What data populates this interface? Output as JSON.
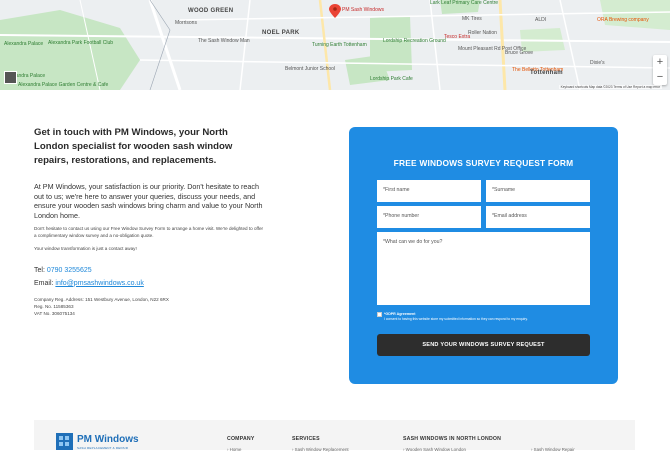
{
  "map": {
    "labels": {
      "wood_green": "WOOD GREEN",
      "noel_park": "NOEL PARK",
      "alexandra_palace": "Alexandra Palace",
      "alexandra_palace_station": "Alexandra Palace",
      "alexandra_park_football": "Alexandra Park Football Club",
      "garden_centre": "Alexandra Palace Garden Centre & Cafe",
      "morrisons": "Morrisons",
      "sash_window_man": "The Sash Window Man",
      "pm_sash_windows": "PM Sash Windows",
      "lordship_rec": "Lordship Recreation Ground",
      "turning_earth": "Turning Earth Tottenham",
      "lordship_park": "Lordship Park Cafe",
      "belmont": "Belmont Junior School",
      "tesco": "Tesco Extra",
      "mount_pleasant": "Mount Pleasant Rd Post Office",
      "bruce_grove": "Bruce Grove",
      "ora_brewing": "ORA Brewing company",
      "aldi": "ALDI",
      "mk_tires": "MK Tires",
      "roller_nation": "Roller Nation",
      "bellotto": "The Bellotto Tottenham",
      "dixie": "Dixie's",
      "lark_primary": "Lark Leaf Primary Care Centre",
      "tottenham": "Tottenham"
    },
    "zoom_in": "+",
    "zoom_out": "−",
    "footer": "Keyboard shortcuts   Map data ©2023   Terms of Use   Report a map error"
  },
  "intro": {
    "headline": "Get in touch with PM Windows, your North London specialist for wooden sash window repairs, restorations, and replacements.",
    "paragraph": "At PM Windows, your satisfaction is our priority. Don't hesitate to reach out to us; we're here to answer your queries, discuss your needs, and ensure your wooden sash windows bring charm and value to your North London home.",
    "small_text": "Don't hesitate to contact us using our Free Window Survey Form to arrange a home visit. We're delighted to offer a complimentary window survey and a no-obligation quote.",
    "small_text2": "Your window transformation is just a contact away!",
    "tel_label": "Tel:",
    "tel_value": "0790 3255625",
    "email_label": "Email:",
    "email_value": "info@pmsashwindows.co.uk",
    "company_address": "Company Reg. Address: 151 Westbury Avenue, London, N22 6RX",
    "reg_no": "Reg. No. 11585363",
    "vat_no": "VAT No. 306075134"
  },
  "form": {
    "title": "FREE WINDOWS SURVEY REQUEST FORM",
    "first_name_placeholder": "*First name",
    "surname_placeholder": "*Surname",
    "phone_placeholder": "*Phone number",
    "email_placeholder": "*Email address",
    "message_placeholder": "*What can we do for you?",
    "gdpr_title": "*GDPR Agreement",
    "gdpr_text": "I consent to having this website store my submitted information so they can respond to my enquiry.",
    "submit_label": "SEND YOUR WINDOWS SURVEY REQUEST"
  },
  "footer": {
    "logo_text": "PM Windows",
    "logo_sub": "SASH REPLACEMENT & REPAIR",
    "col_company": "COMPANY",
    "col_services": "SERVICES",
    "col_sash": "SASH WINDOWS IN NORTH LONDON",
    "company_first": "› Home",
    "services_first": "› Sash Window Replacement",
    "sash_first": "› Wooden Sash Window London",
    "sash_second": "› Sash Window Repair"
  },
  "colors": {
    "form_blue": "#1f8ce3",
    "link_blue": "#1d87d9",
    "submit_dark": "#2d2d2d"
  }
}
